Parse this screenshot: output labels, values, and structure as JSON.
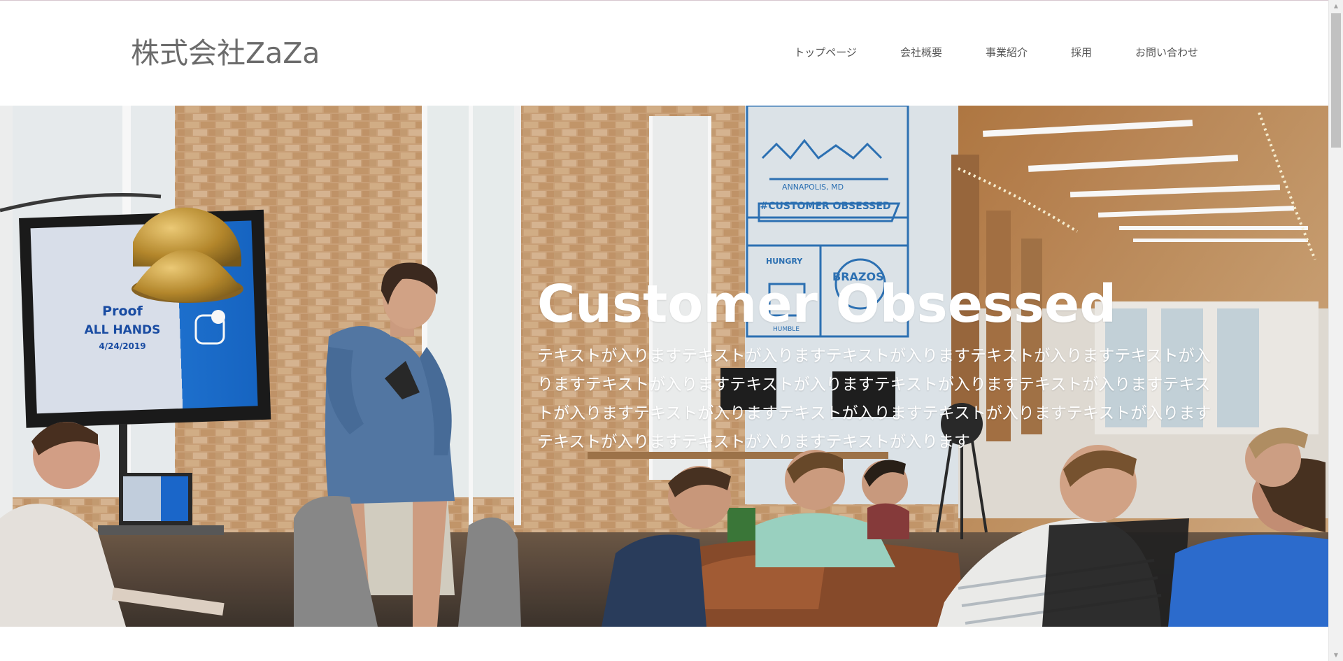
{
  "header": {
    "logo_text": "株式会社ZaZa",
    "nav": [
      {
        "label": "トップページ"
      },
      {
        "label": "会社概要"
      },
      {
        "label": "事業紹介"
      },
      {
        "label": "採用"
      },
      {
        "label": "お問い合わせ"
      }
    ]
  },
  "hero": {
    "title": "Customer Obsessed",
    "body": "テキストが入りますテキストが入りますテキストが入りますテキストが入りますテキストが入りますテキストが入りますテキストが入りますテキストが入りますテキストが入りますテキストが入りますテキストが入りますテキストが入りますテキストが入りますテキストが入りますテキストが入りますテキストが入りますテキストが入ります",
    "image_name": "office-meeting-photo",
    "photo_text": {
      "screen_line1": "Proof",
      "screen_line2": "ALL HANDS",
      "screen_line3": "4/24/2019",
      "mural_city": "ANNAPOLIS, MD",
      "mural_banner": "#CUSTOMER OBSESSED",
      "mural_hungry": "HUNGRY",
      "mural_humble": "HUMBLE",
      "mural_brazos": "BRAZOS"
    }
  },
  "scrollbar": {
    "up_icon": "scroll-up-arrow-icon",
    "down_icon": "scroll-down-arrow-icon",
    "position": 0.0
  },
  "colors": {
    "logo": "#6b6b6b",
    "nav_text": "#555555",
    "hero_text": "#ffffff",
    "page_bg": "#ffffff"
  }
}
